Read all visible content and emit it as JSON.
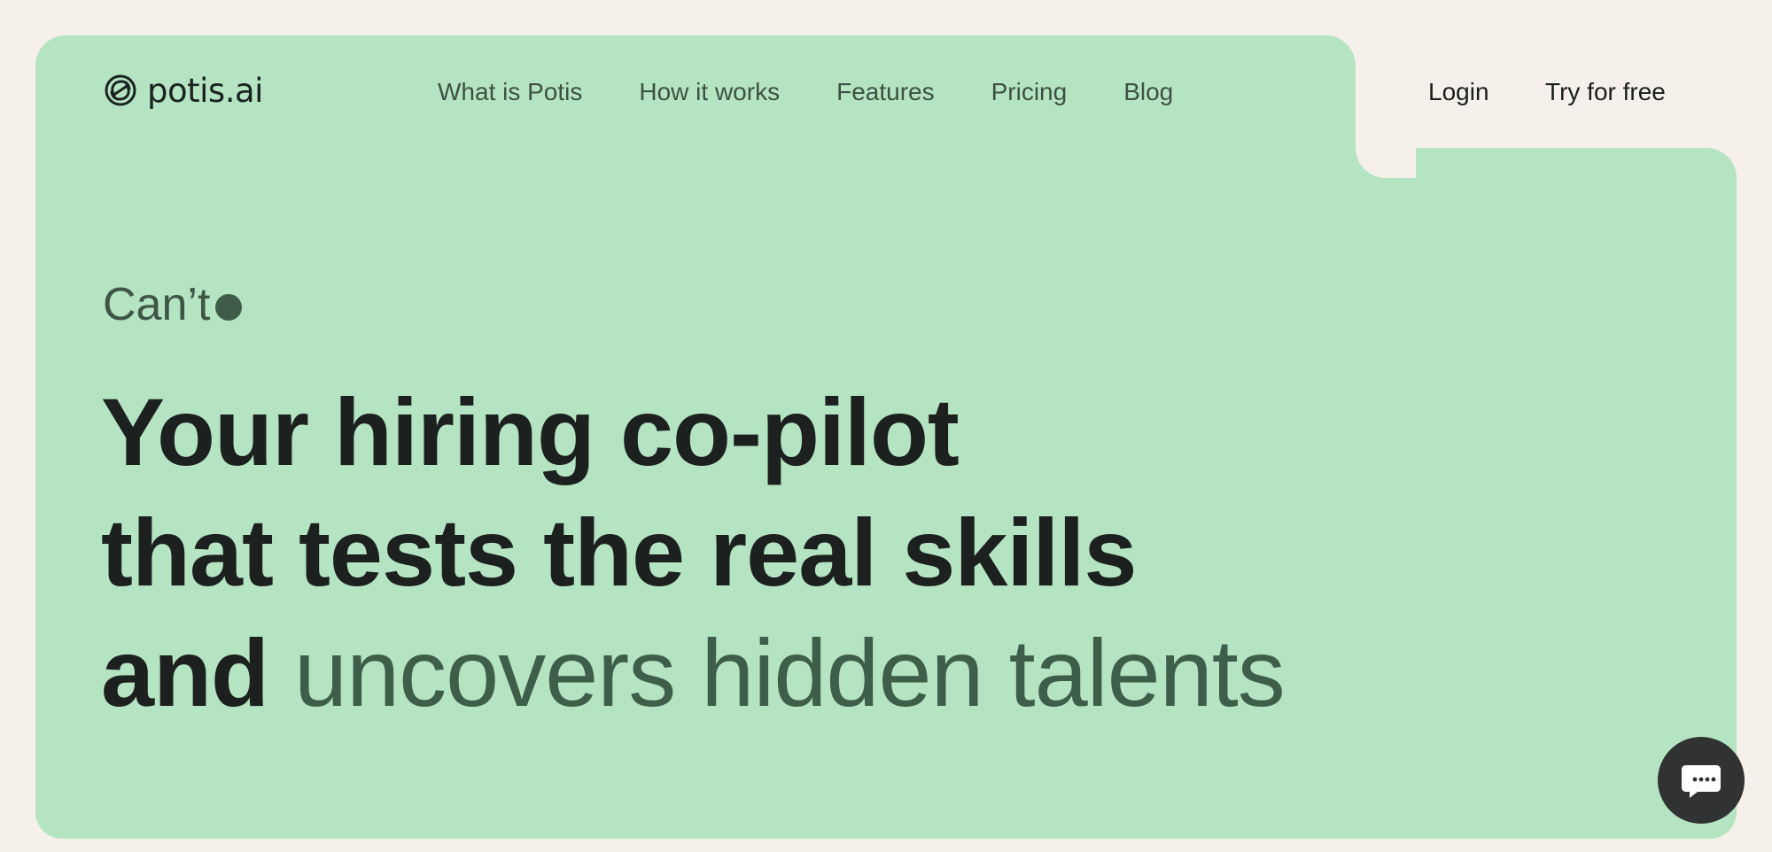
{
  "brand": {
    "name": "potis.ai",
    "logo_icon": "potis-logo-icon"
  },
  "nav": {
    "items": [
      "What is Potis",
      "How it works",
      "Features",
      "Pricing",
      "Blog"
    ]
  },
  "auth": {
    "login_label": "Login",
    "try_label": "Try for free"
  },
  "hero": {
    "eyebrow": "Can’t",
    "headline_line_1": "Your hiring co-pilot",
    "headline_line_2": "that tests the real skills",
    "headline_line_3_start": "and",
    "headline_line_3_accent": "uncovers hidden talents"
  },
  "chat": {
    "icon": "chat-bubble-icon"
  },
  "colors": {
    "page_background": "#f5f0e9",
    "hero_background": "#b5e4c3",
    "headline": "#1c201e",
    "accent": "#3e5e49",
    "nav_text": "#3e5144",
    "chat_button": "#303332"
  }
}
